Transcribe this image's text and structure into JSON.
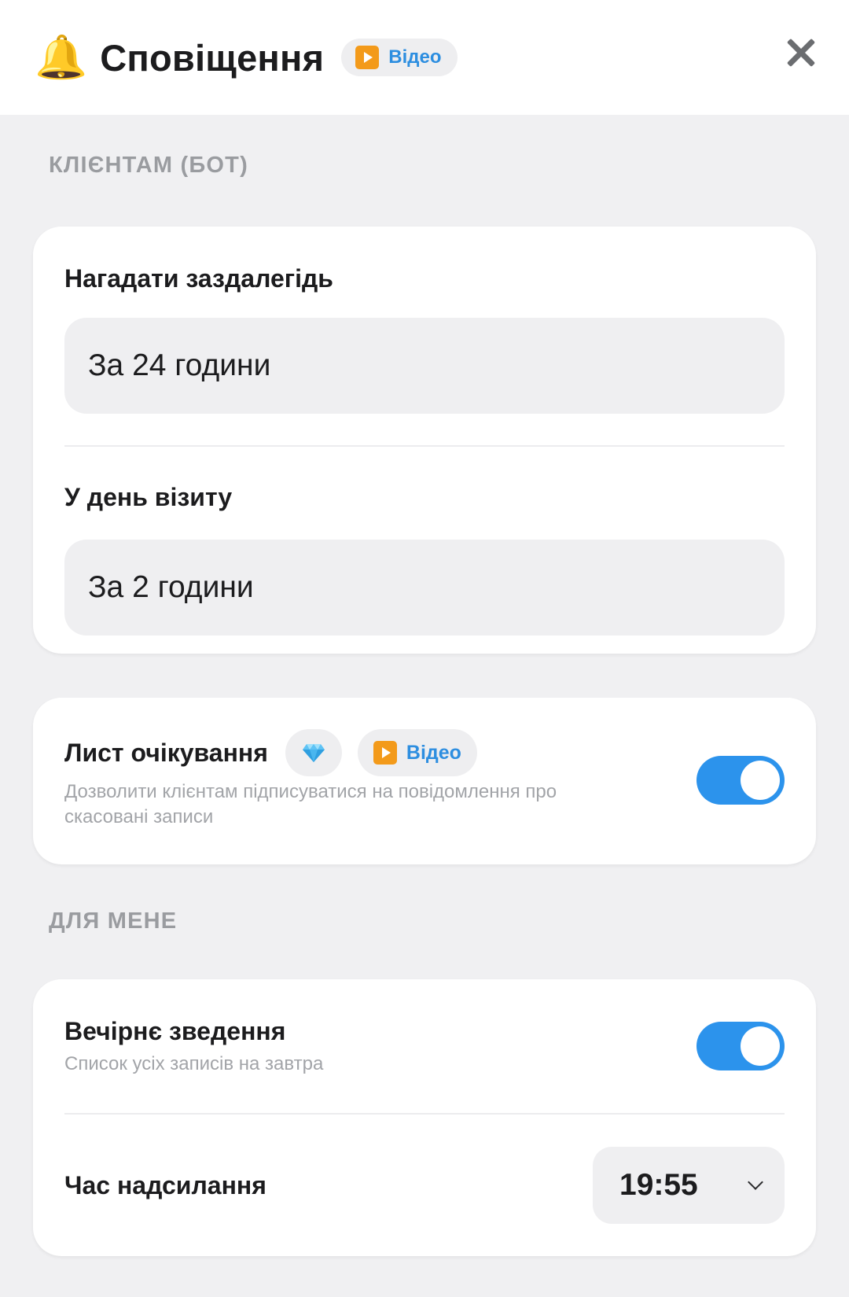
{
  "header": {
    "icon": "bell-icon",
    "title": "Сповіщення",
    "video_label": "Відео"
  },
  "clients_section": {
    "label": "КЛІЄНТАМ (БОТ)",
    "remind_in_advance": {
      "title": "Нагадати заздалегідь",
      "value": "За 24 години"
    },
    "visit_day": {
      "title": "У день візиту",
      "value": "За 2 години"
    },
    "waitlist": {
      "title": "Лист очікування",
      "premium_icon": "diamond-icon",
      "video_label": "Відео",
      "description": "Дозволити клієнтам підписуватися на повідомлення про скасовані записи",
      "enabled": true
    }
  },
  "me_section": {
    "label": "ДЛЯ МЕНЕ",
    "evening_summary": {
      "title": "Вечірнє зведення",
      "description": "Список усіх записів на завтра",
      "enabled": true
    },
    "send_time": {
      "title": "Час надсилання",
      "value": "19:55"
    }
  },
  "colors": {
    "accent": "#2c93ec",
    "link": "#2d8ee0",
    "background": "#f0f0f2"
  }
}
